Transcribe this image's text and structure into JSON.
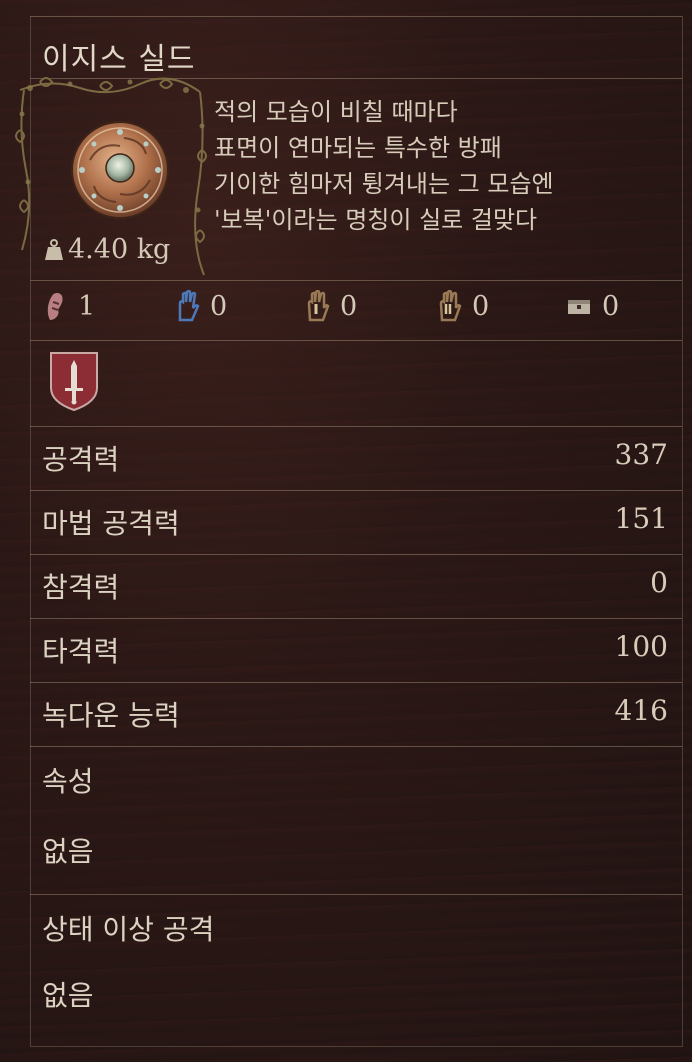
{
  "item": {
    "name": "이지스 실드",
    "icon": "round-ornate-shield-icon",
    "weight": "4.40 kg",
    "description": [
      "적의 모습이 비칠 때마다",
      "표면이 연마되는 특수한 방패",
      "기이한 힘마저 튕겨내는 그 모습엔",
      "'보복'이라는 명칭이 실로 걸맞다"
    ]
  },
  "requirements": [
    {
      "icon": "strength-icon",
      "value": "1",
      "color": "#b87f82"
    },
    {
      "icon": "dexterity-icon",
      "value": "0",
      "color": "#4e79b8"
    },
    {
      "icon": "intelligence-icon",
      "value": "0",
      "color": "#9a7a55"
    },
    {
      "icon": "faith-icon",
      "value": "0",
      "color": "#9a7a55"
    },
    {
      "icon": "arcane-icon",
      "value": "0",
      "color": "#bdb3a4"
    }
  ],
  "category_icon": "sword-crest-icon",
  "stats": [
    {
      "label": "공격력",
      "value": "337"
    },
    {
      "label": "마법 공격력",
      "value": "151"
    },
    {
      "label": "참격력",
      "value": "0"
    },
    {
      "label": "타격력",
      "value": "100"
    },
    {
      "label": "녹다운 능력",
      "value": "416"
    }
  ],
  "attribute": {
    "label": "속성",
    "value": "없음"
  },
  "status_attack": {
    "label": "상태 이상 공격",
    "value": "없음"
  }
}
